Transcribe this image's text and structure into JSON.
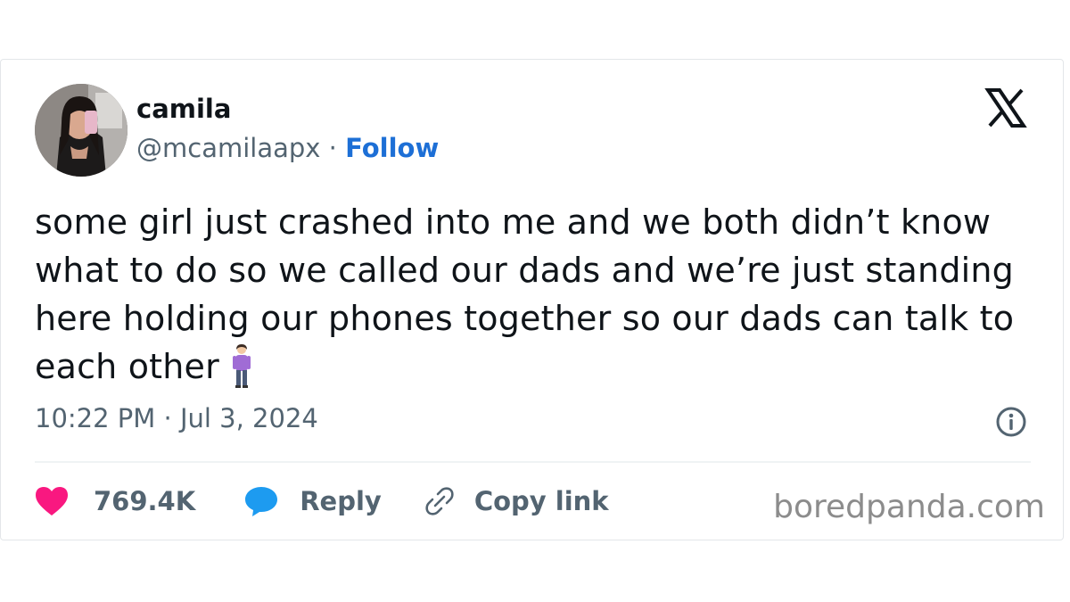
{
  "tweet": {
    "author": {
      "name": "camila",
      "handle": "@mcamilaapx",
      "separator": " · ",
      "follow_label": "Follow"
    },
    "text": "some girl just crashed into me and we both didn’t know what to do so we called our dads and we’re just standing here holding our phones together so our dads can talk to each other",
    "emoji_icon": "person-standing-icon",
    "timestamp": "10:22 PM · Jul 3, 2024",
    "actions": {
      "likes": "769.4K",
      "reply_label": "Reply",
      "copy_link_label": "Copy link"
    },
    "colors": {
      "like": "#f91880",
      "reply": "#1d9bf0",
      "follow": "#1d6fd6",
      "text": "#0f1419",
      "secondary": "#536471"
    }
  },
  "watermark": "boredpanda.com"
}
